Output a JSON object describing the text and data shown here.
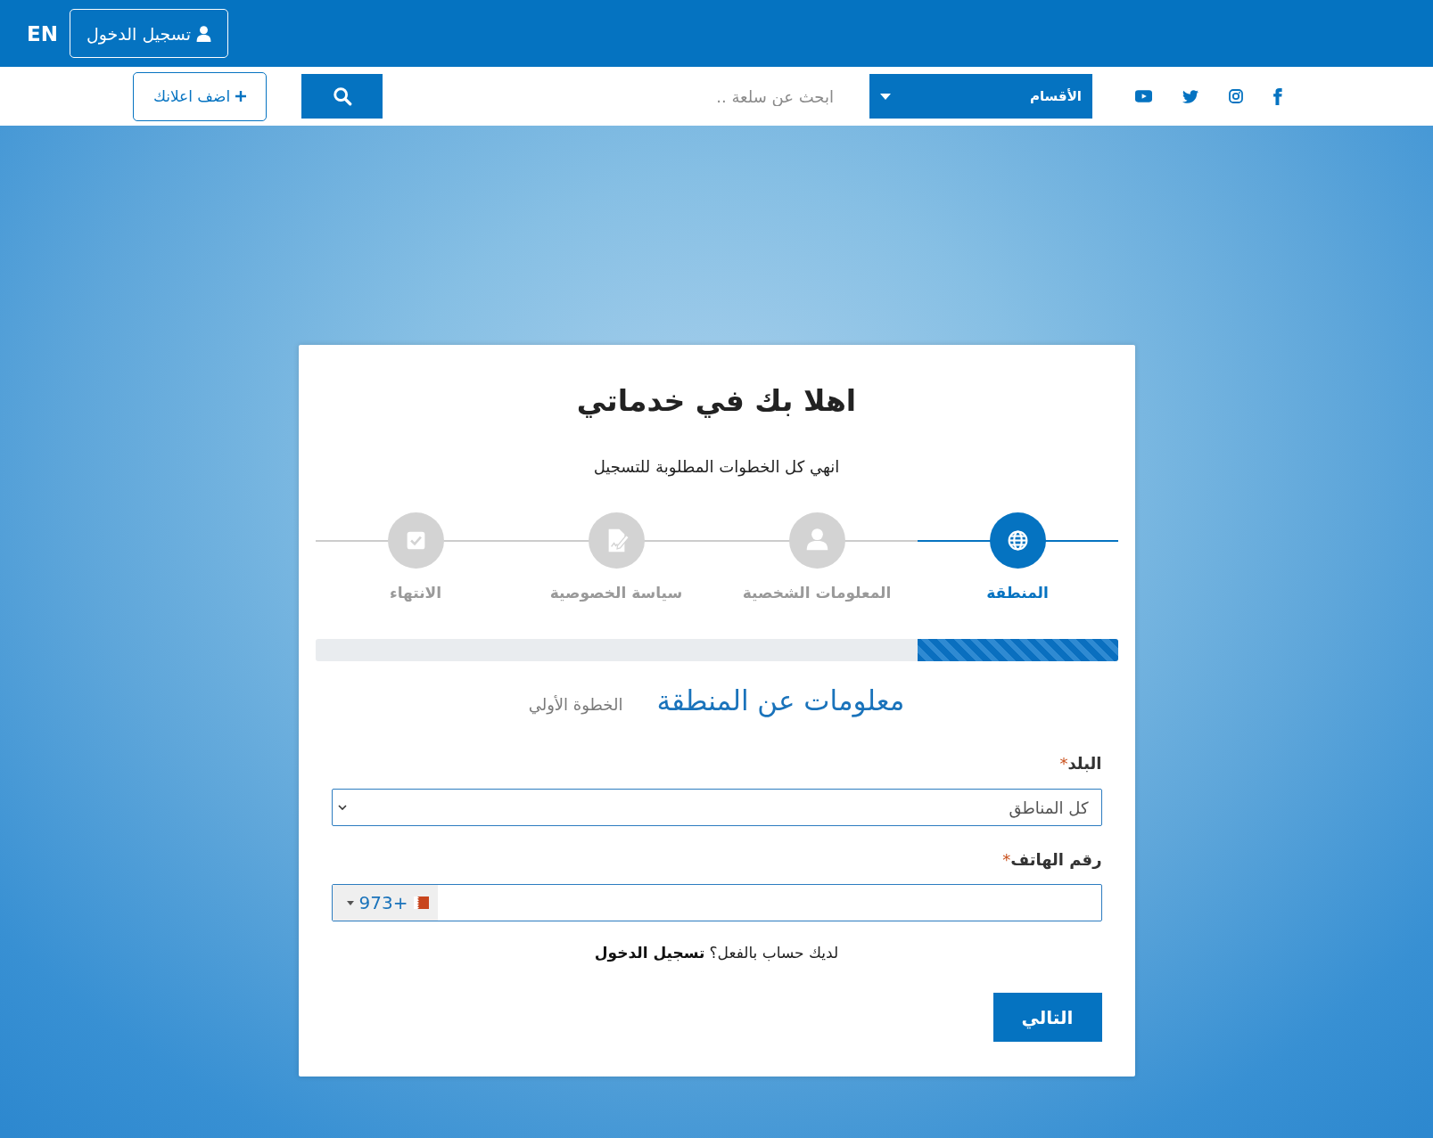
{
  "top_bar": {
    "language": "EN",
    "login_button": "تسجيل الدخول"
  },
  "nav_bar": {
    "categories_dropdown": "الأقسام",
    "search": {
      "placeholder": "ابحث عن سلعة .."
    },
    "add_ad_button": "اضف اعلانك"
  },
  "card": {
    "title": "اهلا بك في خدماتي",
    "subtitle": "انهي كل الخطوات المطلوبة للتسجيل",
    "steps": [
      {
        "label": "المنطقة",
        "selected": true
      },
      {
        "label": "المعلومات الشخصية",
        "selected": false
      },
      {
        "label": "سياسة الخصوصية",
        "selected": false
      },
      {
        "label": "الانتهاء",
        "selected": false
      }
    ],
    "progress": {
      "level": 0.25
    },
    "section": {
      "title": "معلومات عن المنطقة",
      "step_caption": "الخطوة الأولي"
    },
    "fields": [
      {
        "kind": "select",
        "label": "البلد",
        "required_mark": "*",
        "value": "كل المناطق"
      },
      {
        "kind": "phone",
        "label": "رقم الهاتف",
        "required_mark": "*",
        "dial_code": "+973"
      }
    ],
    "login_prompt": {
      "text": "لديك حساب بالفعل؟",
      "link": "تسجيل الدخول"
    },
    "next_button": "التالي"
  }
}
